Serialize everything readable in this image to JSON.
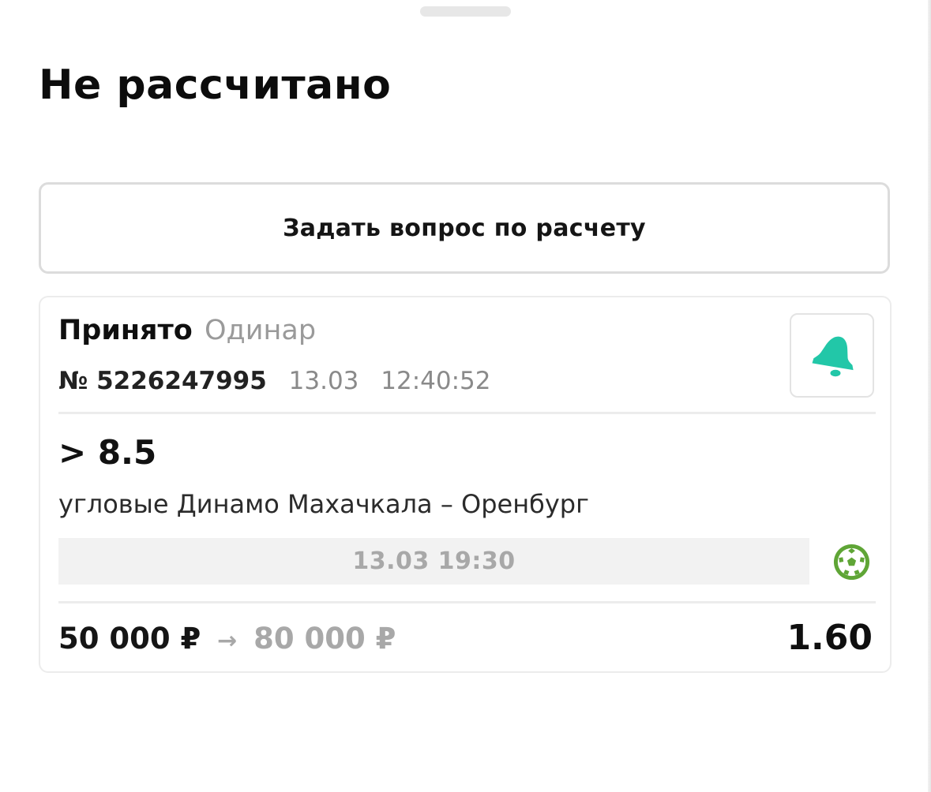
{
  "header": {
    "title": "Не рассчитано"
  },
  "actions": {
    "ask_question_label": "Задать вопрос по расчету"
  },
  "bet": {
    "status": "Принято",
    "type": "Одинар",
    "number": "№ 5226247995",
    "date": "13.03",
    "time": "12:40:52",
    "outcome": "> 8.5",
    "event": "угловые Динамо Махачкала – Оренбург",
    "event_datetime": "13.03 19:30",
    "stake": "50 000 ₽",
    "arrow": "→",
    "payout": "80 000 ₽",
    "odds": "1.60",
    "icons": {
      "notify": "bell-icon",
      "sport": "football-icon"
    },
    "colors": {
      "bell": "#22c7a8",
      "sport": "#5fa536"
    }
  }
}
